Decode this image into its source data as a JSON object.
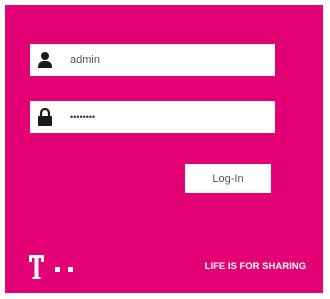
{
  "login_form": {
    "username": {
      "value": "admin",
      "icon": "user-icon"
    },
    "password": {
      "value": "********",
      "icon": "lock-icon"
    },
    "submit_label": "Log-In"
  },
  "branding": {
    "logo": "telekom-t-logo",
    "slogan": "LIFE IS FOR SHARING"
  },
  "colors": {
    "brand_magenta": "#e20074",
    "field_background": "#ffffff",
    "icon": "#1a1a1a"
  }
}
